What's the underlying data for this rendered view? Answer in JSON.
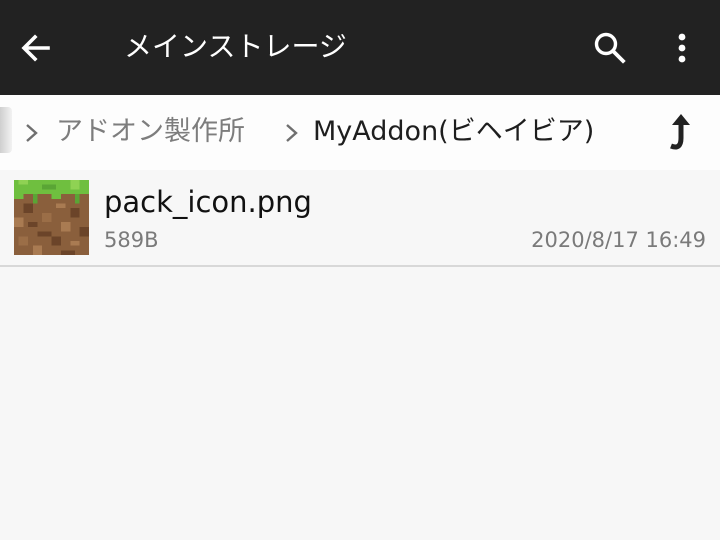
{
  "appbar": {
    "title": "メインストレージ",
    "icons": {
      "back": "arrow-back-icon",
      "search": "search-icon",
      "more": "more-vert-icon"
    }
  },
  "breadcrumb": {
    "items": [
      "アドオン製作所",
      "MyAddon(ビヘイビア)"
    ],
    "icons": {
      "separator": "chevron-right-icon",
      "up": "folder-up-icon"
    }
  },
  "files": [
    {
      "name": "pack_icon.png",
      "size": "589B",
      "modified": "2020/8/17 16:49",
      "thumbnail": "grass-block-image"
    }
  ],
  "colors": {
    "appbar_bg": "#222222",
    "background": "#f7f7f7",
    "breadcrumb_inactive": "#7d7d7d",
    "breadcrumb_active": "#1e1e1e",
    "meta_text": "#7a7a7a"
  }
}
